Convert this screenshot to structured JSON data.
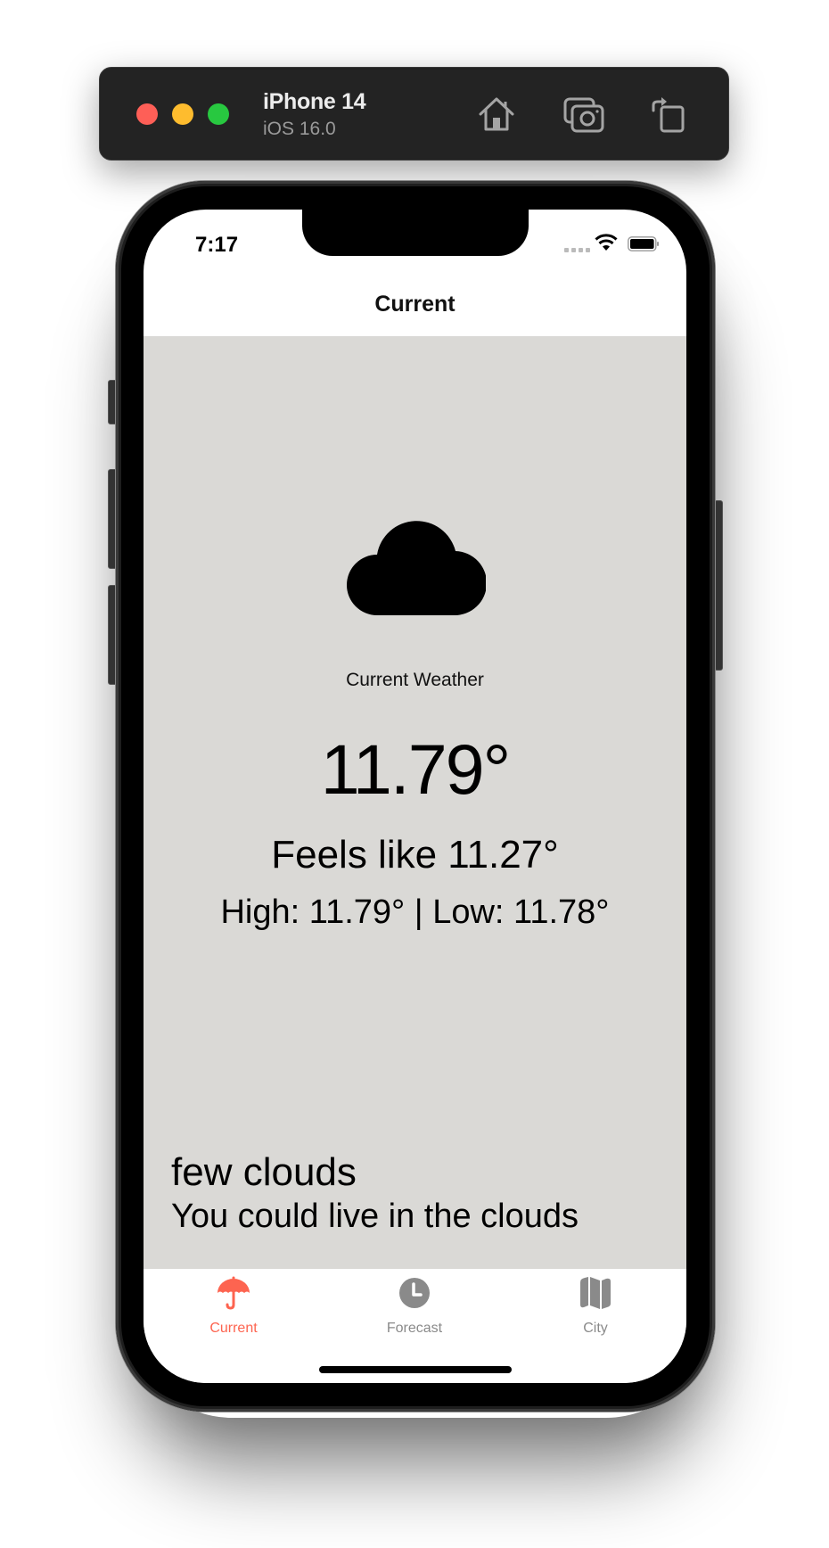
{
  "simulator": {
    "device_name": "iPhone 14",
    "os_version": "iOS 16.0",
    "buttons": [
      {
        "name": "home",
        "icon": "house-icon"
      },
      {
        "name": "screenshot",
        "icon": "camera-icon"
      },
      {
        "name": "rotate",
        "icon": "rotate-icon"
      }
    ],
    "traffic_lights": {
      "close": "#fe5f57",
      "minimize": "#febc2e",
      "zoom": "#28c840"
    }
  },
  "status_bar": {
    "time": "7:17",
    "icons": [
      "cellular-signal-icon",
      "wifi-icon",
      "battery-icon"
    ]
  },
  "nav": {
    "title": "Current"
  },
  "weather": {
    "icon": "cloud-icon",
    "section_label": "Current Weather",
    "temperature": "11.79°",
    "feels_like": "Feels like 11.27°",
    "high_low": "High: 11.79° | Low: 11.78°",
    "description": "few clouds",
    "tagline": "You could live in the clouds",
    "background_color": "#dad9d6"
  },
  "tab_bar": {
    "accent_color": "#fd6450",
    "inactive_color": "#8a8a8a",
    "tabs": [
      {
        "label": "Current",
        "icon": "umbrella-icon",
        "active": true
      },
      {
        "label": "Forecast",
        "icon": "clock-icon",
        "active": false
      },
      {
        "label": "City",
        "icon": "map-icon",
        "active": false
      }
    ]
  }
}
